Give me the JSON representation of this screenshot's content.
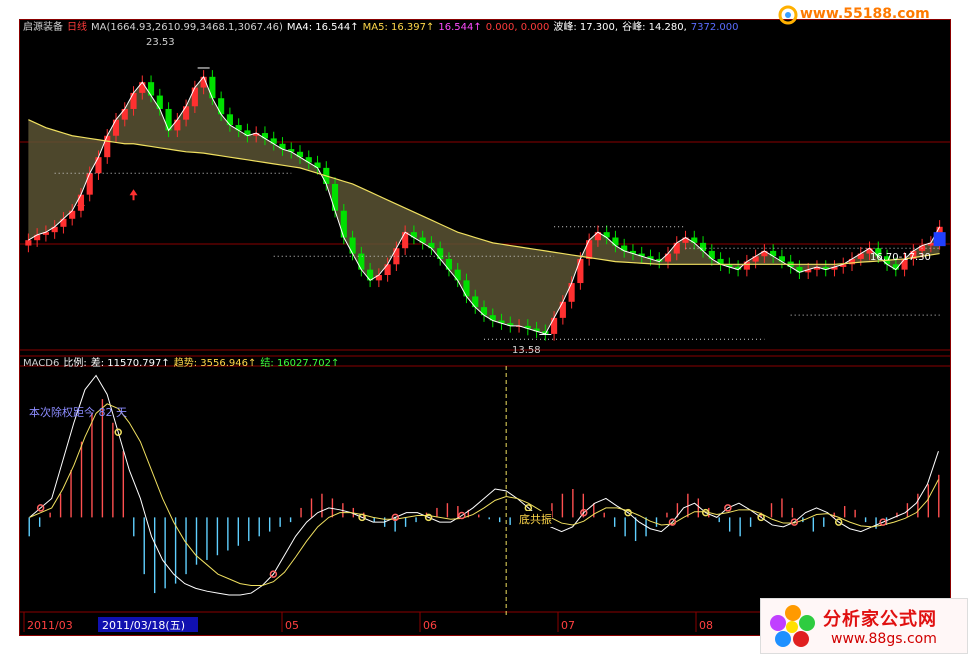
{
  "header": {
    "stock_name": "启源装备",
    "period": "日线",
    "ma_label": "MA(1664.93,2610.99,3468.1,3067.46)",
    "ma4_label": "MA4: 16.544↑",
    "ma5_label": "MA5: 16.397↑",
    "mag_value": "16.544↑",
    "zero_values": "0.000, 0.000",
    "peak_label": "波峰: 17.300,",
    "valley_label": "谷峰: 14.280,",
    "extra_label": "7372.000"
  },
  "macd_header": {
    "name": "MACD6",
    "ratio_label": "比例:",
    "diff_label": "差: 11570.797↑",
    "trend_label": "趋势: 3556.946↑",
    "result_label": "结: 16027.702↑"
  },
  "annotations": {
    "high_price": "23.53",
    "low_price": "13.58",
    "range_label": "16.70-17.30",
    "ex_rights_note": "本次除权距今 82 天",
    "resonance_label": "底共振"
  },
  "date_axis": {
    "labels": [
      "2011/03",
      "05",
      "06",
      "07",
      "08"
    ],
    "cursor_label": "2011/03/18(五)"
  },
  "watermarks": {
    "top": "www.55188.com",
    "brand": "分析家公式网",
    "url": "www.88gs.com"
  },
  "colors": {
    "up": "#ff3030",
    "down": "#00e000",
    "ma_yellow": "#f0e060",
    "ma_white": "#ffffff",
    "grid": "#8a0000",
    "fill_bull": "#6a1a14",
    "fill_bear": "#5a5434"
  },
  "chart_data": [
    {
      "type": "candlestick",
      "title": "启源装备 日线",
      "ylim": [
        13.0,
        24.5
      ],
      "max_mark": 23.53,
      "min_mark": 13.58,
      "closes": [
        17.1,
        17.3,
        17.4,
        17.6,
        17.9,
        18.2,
        18.8,
        19.6,
        20.2,
        21.0,
        21.6,
        22.0,
        22.6,
        23.0,
        22.5,
        22.0,
        21.2,
        21.6,
        22.1,
        22.8,
        23.2,
        22.4,
        21.8,
        21.4,
        21.2,
        21.0,
        21.1,
        20.9,
        20.7,
        20.5,
        20.4,
        20.2,
        20.0,
        19.8,
        19.2,
        18.2,
        17.2,
        16.6,
        16.0,
        15.6,
        15.8,
        16.2,
        16.8,
        17.4,
        17.2,
        17.0,
        16.8,
        16.4,
        16.0,
        15.6,
        15.0,
        14.6,
        14.3,
        14.1,
        14.0,
        13.9,
        13.9,
        13.8,
        13.7,
        13.6,
        14.2,
        14.8,
        15.5,
        16.4,
        17.1,
        17.4,
        17.2,
        16.9,
        16.7,
        16.6,
        16.5,
        16.4,
        16.3,
        16.6,
        17.0,
        17.2,
        17.0,
        16.7,
        16.4,
        16.2,
        16.1,
        16.0,
        16.3,
        16.5,
        16.7,
        16.5,
        16.3,
        16.1,
        15.9,
        16.0,
        16.1,
        16.0,
        16.1,
        16.2,
        16.4,
        16.6,
        16.8,
        16.5,
        16.2,
        16.0,
        16.4,
        16.7,
        16.9,
        17.0,
        17.6
      ],
      "ma_slow": [
        21.6,
        21.45,
        21.3,
        21.2,
        21.1,
        21.0,
        20.95,
        20.9,
        20.85,
        20.8,
        20.75,
        20.7,
        20.7,
        20.65,
        20.6,
        20.55,
        20.5,
        20.45,
        20.4,
        20.38,
        20.35,
        20.3,
        20.25,
        20.2,
        20.15,
        20.1,
        20.05,
        20.0,
        19.95,
        19.9,
        19.85,
        19.8,
        19.7,
        19.6,
        19.5,
        19.4,
        19.3,
        19.2,
        19.05,
        18.9,
        18.75,
        18.6,
        18.45,
        18.3,
        18.15,
        18.0,
        17.85,
        17.7,
        17.55,
        17.4,
        17.3,
        17.2,
        17.1,
        17.0,
        16.95,
        16.9,
        16.85,
        16.8,
        16.75,
        16.7,
        16.65,
        16.6,
        16.55,
        16.5,
        16.45,
        16.4,
        16.35,
        16.3,
        16.28,
        16.26,
        16.24,
        16.22,
        16.2,
        16.2,
        16.2,
        16.2,
        16.2,
        16.2,
        16.2,
        16.2,
        16.2,
        16.2,
        16.2,
        16.2,
        16.2,
        16.2,
        16.2,
        16.2,
        16.2,
        16.2,
        16.2,
        16.2,
        16.2,
        16.22,
        16.25,
        16.28,
        16.3,
        16.32,
        16.35,
        16.38,
        16.4,
        16.45,
        16.5,
        16.55,
        16.6
      ]
    },
    {
      "type": "bar",
      "title": "MACD6",
      "ylim": [
        -1.0,
        1.6
      ],
      "values": [
        -0.2,
        -0.1,
        0.05,
        0.25,
        0.5,
        0.8,
        1.1,
        1.25,
        1.0,
        0.7,
        -0.2,
        -0.6,
        -0.8,
        -0.75,
        -0.7,
        -0.6,
        -0.5,
        -0.45,
        -0.4,
        -0.35,
        -0.3,
        -0.25,
        -0.2,
        -0.15,
        -0.1,
        -0.05,
        0.1,
        0.2,
        0.25,
        0.2,
        0.15,
        0.1,
        0.05,
        -0.05,
        -0.1,
        -0.15,
        -0.1,
        -0.05,
        0.05,
        0.1,
        0.15,
        0.12,
        0.08,
        0.03,
        -0.02,
        -0.05,
        -0.08,
        -0.1,
        -0.05,
        0.05,
        0.15,
        0.25,
        0.3,
        0.25,
        0.15,
        0.05,
        -0.1,
        -0.2,
        -0.25,
        -0.2,
        -0.1,
        0.05,
        0.15,
        0.25,
        0.2,
        0.1,
        -0.05,
        -0.15,
        -0.2,
        -0.1,
        0.05,
        0.15,
        0.2,
        0.1,
        -0.05,
        -0.15,
        -0.1,
        0.05,
        0.12,
        0.08,
        -0.05,
        -0.12,
        -0.08,
        0.05,
        0.15,
        0.25,
        0.35,
        0.45
      ],
      "diff": [
        0.0,
        0.1,
        0.2,
        0.6,
        1.0,
        1.35,
        1.5,
        1.3,
        0.9,
        0.5,
        0.2,
        -0.2,
        -0.45,
        -0.6,
        -0.7,
        -0.75,
        -0.78,
        -0.8,
        -0.82,
        -0.82,
        -0.8,
        -0.72,
        -0.6,
        -0.4,
        -0.2,
        -0.05,
        0.05,
        0.1,
        0.08,
        0.05,
        0.0,
        -0.05,
        -0.05,
        0.0,
        0.05,
        0.05,
        0.0,
        -0.05,
        -0.05,
        0.02,
        0.1,
        0.2,
        0.3,
        0.28,
        0.2,
        0.1,
        0.0,
        -0.1,
        -0.15,
        -0.1,
        0.05,
        0.15,
        0.2,
        0.12,
        0.05,
        -0.05,
        -0.12,
        -0.15,
        -0.05,
        0.1,
        0.15,
        0.05,
        0.0,
        0.1,
        0.15,
        0.08,
        0.0,
        -0.08,
        -0.1,
        -0.05,
        0.05,
        0.1,
        0.05,
        -0.05,
        -0.12,
        -0.15,
        -0.1,
        -0.05,
        0.0,
        0.05,
        0.15,
        0.35,
        0.7
      ],
      "dea": [
        0.0,
        0.05,
        0.1,
        0.3,
        0.55,
        0.85,
        1.1,
        1.2,
        1.15,
        1.0,
        0.8,
        0.5,
        0.2,
        -0.05,
        -0.25,
        -0.4,
        -0.5,
        -0.6,
        -0.65,
        -0.7,
        -0.72,
        -0.72,
        -0.68,
        -0.58,
        -0.42,
        -0.25,
        -0.1,
        0.0,
        0.05,
        0.05,
        0.03,
        0.0,
        -0.02,
        -0.02,
        0.0,
        0.02,
        0.02,
        0.0,
        -0.02,
        -0.01,
        0.03,
        0.1,
        0.18,
        0.22,
        0.2,
        0.15,
        0.08,
        0.0,
        -0.06,
        -0.08,
        -0.04,
        0.04,
        0.1,
        0.1,
        0.07,
        0.02,
        -0.04,
        -0.08,
        -0.07,
        0.0,
        0.06,
        0.06,
        0.03,
        0.05,
        0.08,
        0.08,
        0.04,
        -0.02,
        -0.06,
        -0.06,
        -0.02,
        0.03,
        0.04,
        0.0,
        -0.05,
        -0.09,
        -0.1,
        -0.08,
        -0.05,
        -0.01,
        0.05,
        0.18,
        0.4
      ]
    }
  ]
}
